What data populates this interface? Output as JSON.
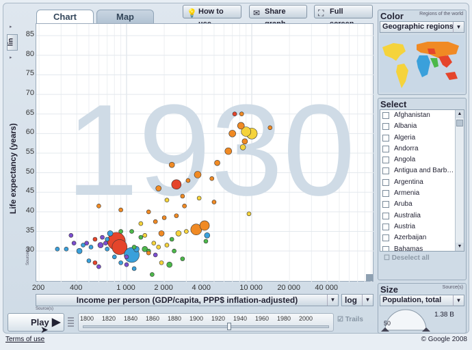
{
  "tabs": {
    "chart": "Chart",
    "map": "Map"
  },
  "toolbar": {
    "how_to_use": "How to use",
    "share_graph": "Share graph",
    "full_screen": "Full screen"
  },
  "y_axis": {
    "label": "Life expectancy (years)",
    "scale_button": "lin"
  },
  "x_axis": {
    "label": "Income per person (GDP/capita, PPP$ inflation-adjusted)",
    "scale": "log"
  },
  "source_label": "Source(s)",
  "color_panel": {
    "title": "Color",
    "sub": "Regions of the world",
    "selected": "Geographic regions",
    "colors": {
      "americas": "#f5d33c",
      "europe_asia": "#f08a24",
      "africa": "#3aa0db",
      "south_asia": "#4cb84a",
      "east_asia": "#e5452b",
      "other": "#7b4fd0"
    }
  },
  "select_panel": {
    "title": "Select",
    "countries": [
      "Afghanistan",
      "Albania",
      "Algeria",
      "Andorra",
      "Angola",
      "Antigua and Barb…",
      "Argentina",
      "Armenia",
      "Aruba",
      "Australia",
      "Austria",
      "Azerbaijan",
      "Bahamas"
    ],
    "deselect": "Deselect all"
  },
  "size_panel": {
    "title": "Size",
    "sub": "Source(s)",
    "selected": "Population, total",
    "gauge_max": "1.38 B",
    "gauge_min": "50"
  },
  "playback": {
    "play": "Play",
    "trails": "Trails",
    "years": [
      "1800",
      "1820",
      "1840",
      "1860",
      "1880",
      "1900",
      "1920",
      "1940",
      "1960",
      "1980",
      "2000"
    ],
    "current_year": 1930
  },
  "footer": {
    "terms": "Terms of use",
    "copyright": "© Google 2008"
  },
  "chart_data": {
    "type": "scatter",
    "year_watermark": "1930",
    "xlabel": "Income per person (GDP/capita, PPP$ inflation-adjusted)",
    "ylabel": "Life expectancy (years)",
    "xscale": "log",
    "xlim": [
      190,
      95000
    ],
    "ylim": [
      22,
      88
    ],
    "x_ticks": [
      "200",
      "400",
      "1 000",
      "2 000",
      "4 000",
      "10 000",
      "20 000",
      "40 000"
    ],
    "x_tick_values": [
      200,
      400,
      1000,
      2000,
      4000,
      10000,
      20000,
      40000
    ],
    "y_ticks": [
      30,
      35,
      40,
      45,
      50,
      55,
      60,
      65,
      70,
      75,
      80,
      85
    ],
    "points": [
      {
        "x": 830,
        "y": 32.5,
        "size": 13,
        "color": "#e5452b"
      },
      {
        "x": 880,
        "y": 31,
        "size": 11,
        "color": "#e5452b"
      },
      {
        "x": 1100,
        "y": 29,
        "size": 11,
        "color": "#3aa0db"
      },
      {
        "x": 2500,
        "y": 47,
        "size": 7,
        "color": "#e5452b"
      },
      {
        "x": 4200,
        "y": 36.5,
        "size": 7,
        "color": "#f08a24"
      },
      {
        "x": 9000,
        "y": 60.5,
        "size": 7,
        "color": "#f5d33c"
      },
      {
        "x": 10000,
        "y": 60,
        "size": 8,
        "color": "#f5d33c"
      },
      {
        "x": 3700,
        "y": 49.5,
        "size": 5,
        "color": "#f08a24"
      },
      {
        "x": 7000,
        "y": 60,
        "size": 5,
        "color": "#f08a24"
      },
      {
        "x": 8200,
        "y": 62,
        "size": 5,
        "color": "#f08a24"
      },
      {
        "x": 6500,
        "y": 55.5,
        "size": 5,
        "color": "#f08a24"
      },
      {
        "x": 8500,
        "y": 56.5,
        "size": 4,
        "color": "#f5d33c"
      },
      {
        "x": 7300,
        "y": 65,
        "size": 3,
        "color": "#e5452b"
      },
      {
        "x": 8300,
        "y": 65,
        "size": 3,
        "color": "#f08a24"
      },
      {
        "x": 8800,
        "y": 58,
        "size": 4,
        "color": "#f08a24"
      },
      {
        "x": 14000,
        "y": 61.5,
        "size": 3,
        "color": "#f08a24"
      },
      {
        "x": 5300,
        "y": 52.5,
        "size": 4,
        "color": "#f08a24"
      },
      {
        "x": 4800,
        "y": 48.5,
        "size": 3,
        "color": "#f08a24"
      },
      {
        "x": 3100,
        "y": 48,
        "size": 3,
        "color": "#f08a24"
      },
      {
        "x": 2300,
        "y": 52,
        "size": 4,
        "color": "#f08a24"
      },
      {
        "x": 1800,
        "y": 46,
        "size": 4,
        "color": "#f08a24"
      },
      {
        "x": 2800,
        "y": 44,
        "size": 3,
        "color": "#f08a24"
      },
      {
        "x": 2900,
        "y": 41.5,
        "size": 3,
        "color": "#f08a24"
      },
      {
        "x": 3800,
        "y": 43.5,
        "size": 3,
        "color": "#f5d33c"
      },
      {
        "x": 2100,
        "y": 43,
        "size": 3,
        "color": "#f5d33c"
      },
      {
        "x": 1500,
        "y": 40,
        "size": 3,
        "color": "#f08a24"
      },
      {
        "x": 600,
        "y": 41.5,
        "size": 3,
        "color": "#f08a24"
      },
      {
        "x": 900,
        "y": 40.5,
        "size": 3,
        "color": "#f08a24"
      },
      {
        "x": 2500,
        "y": 39,
        "size": 3,
        "color": "#f08a24"
      },
      {
        "x": 3600,
        "y": 35.5,
        "size": 8,
        "color": "#f08a24"
      },
      {
        "x": 2600,
        "y": 34.5,
        "size": 4,
        "color": "#f5d33c"
      },
      {
        "x": 3000,
        "y": 35,
        "size": 3,
        "color": "#f5d33c"
      },
      {
        "x": 1900,
        "y": 34.5,
        "size": 4,
        "color": "#f08a24"
      },
      {
        "x": 1400,
        "y": 34,
        "size": 3,
        "color": "#f5d33c"
      },
      {
        "x": 1650,
        "y": 32,
        "size": 3,
        "color": "#f5d33c"
      },
      {
        "x": 1800,
        "y": 31,
        "size": 3,
        "color": "#f5d33c"
      },
      {
        "x": 2100,
        "y": 31.5,
        "size": 3,
        "color": "#f5d33c"
      },
      {
        "x": 2300,
        "y": 33,
        "size": 3,
        "color": "#4cb84a"
      },
      {
        "x": 1500,
        "y": 30,
        "size": 3,
        "color": "#4cb84a"
      },
      {
        "x": 1300,
        "y": 33.5,
        "size": 3,
        "color": "#4cb84a"
      },
      {
        "x": 1150,
        "y": 31,
        "size": 3,
        "color": "#4cb84a"
      },
      {
        "x": 4400,
        "y": 34,
        "size": 4,
        "color": "#3aa0db"
      },
      {
        "x": 4300,
        "y": 32.5,
        "size": 3,
        "color": "#4cb84a"
      },
      {
        "x": 5000,
        "y": 42.5,
        "size": 3,
        "color": "#f08a24"
      },
      {
        "x": 1000,
        "y": 28.5,
        "size": 3,
        "color": "#7b4fd0"
      },
      {
        "x": 1200,
        "y": 30.5,
        "size": 4,
        "color": "#3aa0db"
      },
      {
        "x": 1000,
        "y": 26.5,
        "size": 3,
        "color": "#7b4fd0"
      },
      {
        "x": 900,
        "y": 27,
        "size": 3,
        "color": "#3aa0db"
      },
      {
        "x": 800,
        "y": 28.5,
        "size": 3,
        "color": "#3aa0db"
      },
      {
        "x": 700,
        "y": 30.5,
        "size": 3,
        "color": "#3aa0db"
      },
      {
        "x": 620,
        "y": 31.5,
        "size": 4,
        "color": "#7b4fd0"
      },
      {
        "x": 560,
        "y": 33,
        "size": 3,
        "color": "#e5452b"
      },
      {
        "x": 640,
        "y": 33.5,
        "size": 3,
        "color": "#7b4fd0"
      },
      {
        "x": 700,
        "y": 33,
        "size": 3,
        "color": "#3aa0db"
      },
      {
        "x": 740,
        "y": 34.5,
        "size": 4,
        "color": "#3aa0db"
      },
      {
        "x": 680,
        "y": 32,
        "size": 3,
        "color": "#7b4fd0"
      },
      {
        "x": 520,
        "y": 31,
        "size": 3,
        "color": "#3aa0db"
      },
      {
        "x": 480,
        "y": 32,
        "size": 3,
        "color": "#7b4fd0"
      },
      {
        "x": 450,
        "y": 31.5,
        "size": 3,
        "color": "#3aa0db"
      },
      {
        "x": 420,
        "y": 30,
        "size": 4,
        "color": "#3aa0db"
      },
      {
        "x": 380,
        "y": 32,
        "size": 3,
        "color": "#7b4fd0"
      },
      {
        "x": 330,
        "y": 30.5,
        "size": 3,
        "color": "#3aa0db"
      },
      {
        "x": 280,
        "y": 30.5,
        "size": 3,
        "color": "#3aa0db"
      },
      {
        "x": 360,
        "y": 34,
        "size": 3,
        "color": "#7b4fd0"
      },
      {
        "x": 500,
        "y": 27.5,
        "size": 3,
        "color": "#3aa0db"
      },
      {
        "x": 560,
        "y": 27,
        "size": 3,
        "color": "#e5452b"
      },
      {
        "x": 600,
        "y": 26,
        "size": 3,
        "color": "#7b4fd0"
      },
      {
        "x": 1150,
        "y": 25.5,
        "size": 3,
        "color": "#3aa0db"
      },
      {
        "x": 1500,
        "y": 29.5,
        "size": 3,
        "color": "#f08a24"
      },
      {
        "x": 1700,
        "y": 29,
        "size": 3,
        "color": "#7b4fd0"
      },
      {
        "x": 1900,
        "y": 27,
        "size": 3,
        "color": "#f5d33c"
      },
      {
        "x": 2200,
        "y": 26.5,
        "size": 4,
        "color": "#4cb84a"
      },
      {
        "x": 2800,
        "y": 28,
        "size": 3,
        "color": "#4cb84a"
      },
      {
        "x": 2400,
        "y": 30,
        "size": 3,
        "color": "#4cb84a"
      },
      {
        "x": 2000,
        "y": 38.5,
        "size": 3,
        "color": "#f08a24"
      },
      {
        "x": 1300,
        "y": 37,
        "size": 3,
        "color": "#f5d33c"
      },
      {
        "x": 1700,
        "y": 37.5,
        "size": 3,
        "color": "#f08a24"
      },
      {
        "x": 900,
        "y": 35,
        "size": 3,
        "color": "#4cb84a"
      },
      {
        "x": 1100,
        "y": 35,
        "size": 3,
        "color": "#4cb84a"
      },
      {
        "x": 1600,
        "y": 24,
        "size": 3,
        "color": "#4cb84a"
      },
      {
        "x": 1400,
        "y": 30.5,
        "size": 4,
        "color": "#4cb84a"
      },
      {
        "x": 9500,
        "y": 39.5,
        "size": 3,
        "color": "#f5d33c"
      }
    ]
  }
}
